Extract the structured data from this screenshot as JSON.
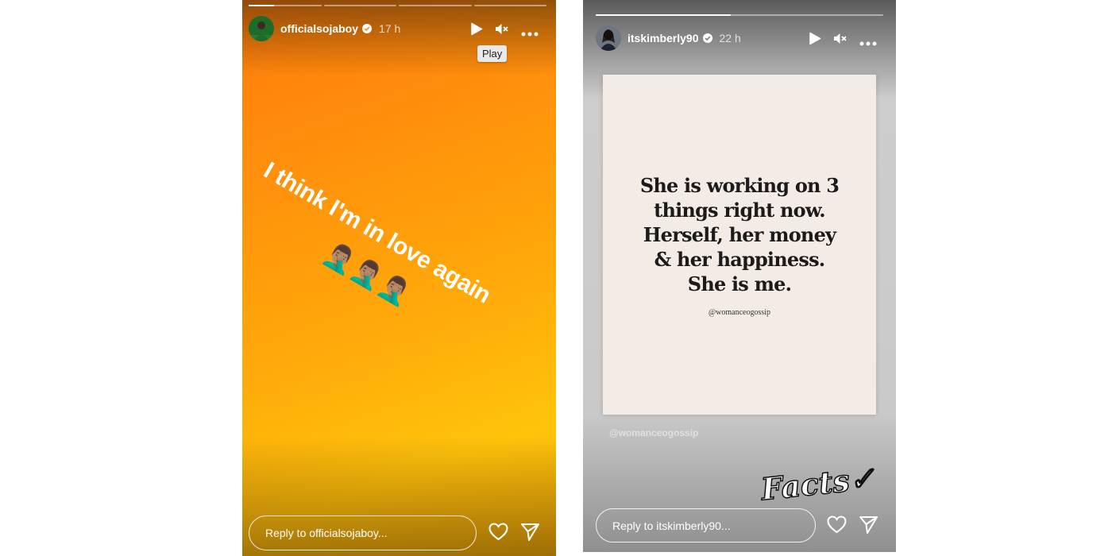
{
  "story_left": {
    "username": "officialsojaboy",
    "time": "17 h",
    "progress": [
      0.35,
      0,
      0,
      0
    ],
    "tooltip": "Play",
    "story_text": "I think I'm in love again",
    "emoji": "🤦🏽‍♂️🤦🏽‍♂️🤦🏽‍♂️",
    "reply_placeholder": "Reply to officialsojaboy...",
    "icons": [
      "play-icon",
      "mute-icon",
      "more-icon",
      "heart-icon",
      "send-icon"
    ]
  },
  "story_right": {
    "username": "itskimberly90",
    "time": "22 h",
    "progress": [
      0.47
    ],
    "quote_lines": [
      "She is working on 3",
      "things right now.",
      "Herself, her money",
      "& her happiness.",
      "She is me."
    ],
    "quote_handle": "@womanceogossip",
    "watermark": "@womanceogossip",
    "sticker": "Facts✓",
    "reply_placeholder": "Reply to itskimberly90...",
    "icons": [
      "play-icon",
      "mute-icon",
      "more-icon",
      "heart-icon",
      "send-icon"
    ]
  }
}
